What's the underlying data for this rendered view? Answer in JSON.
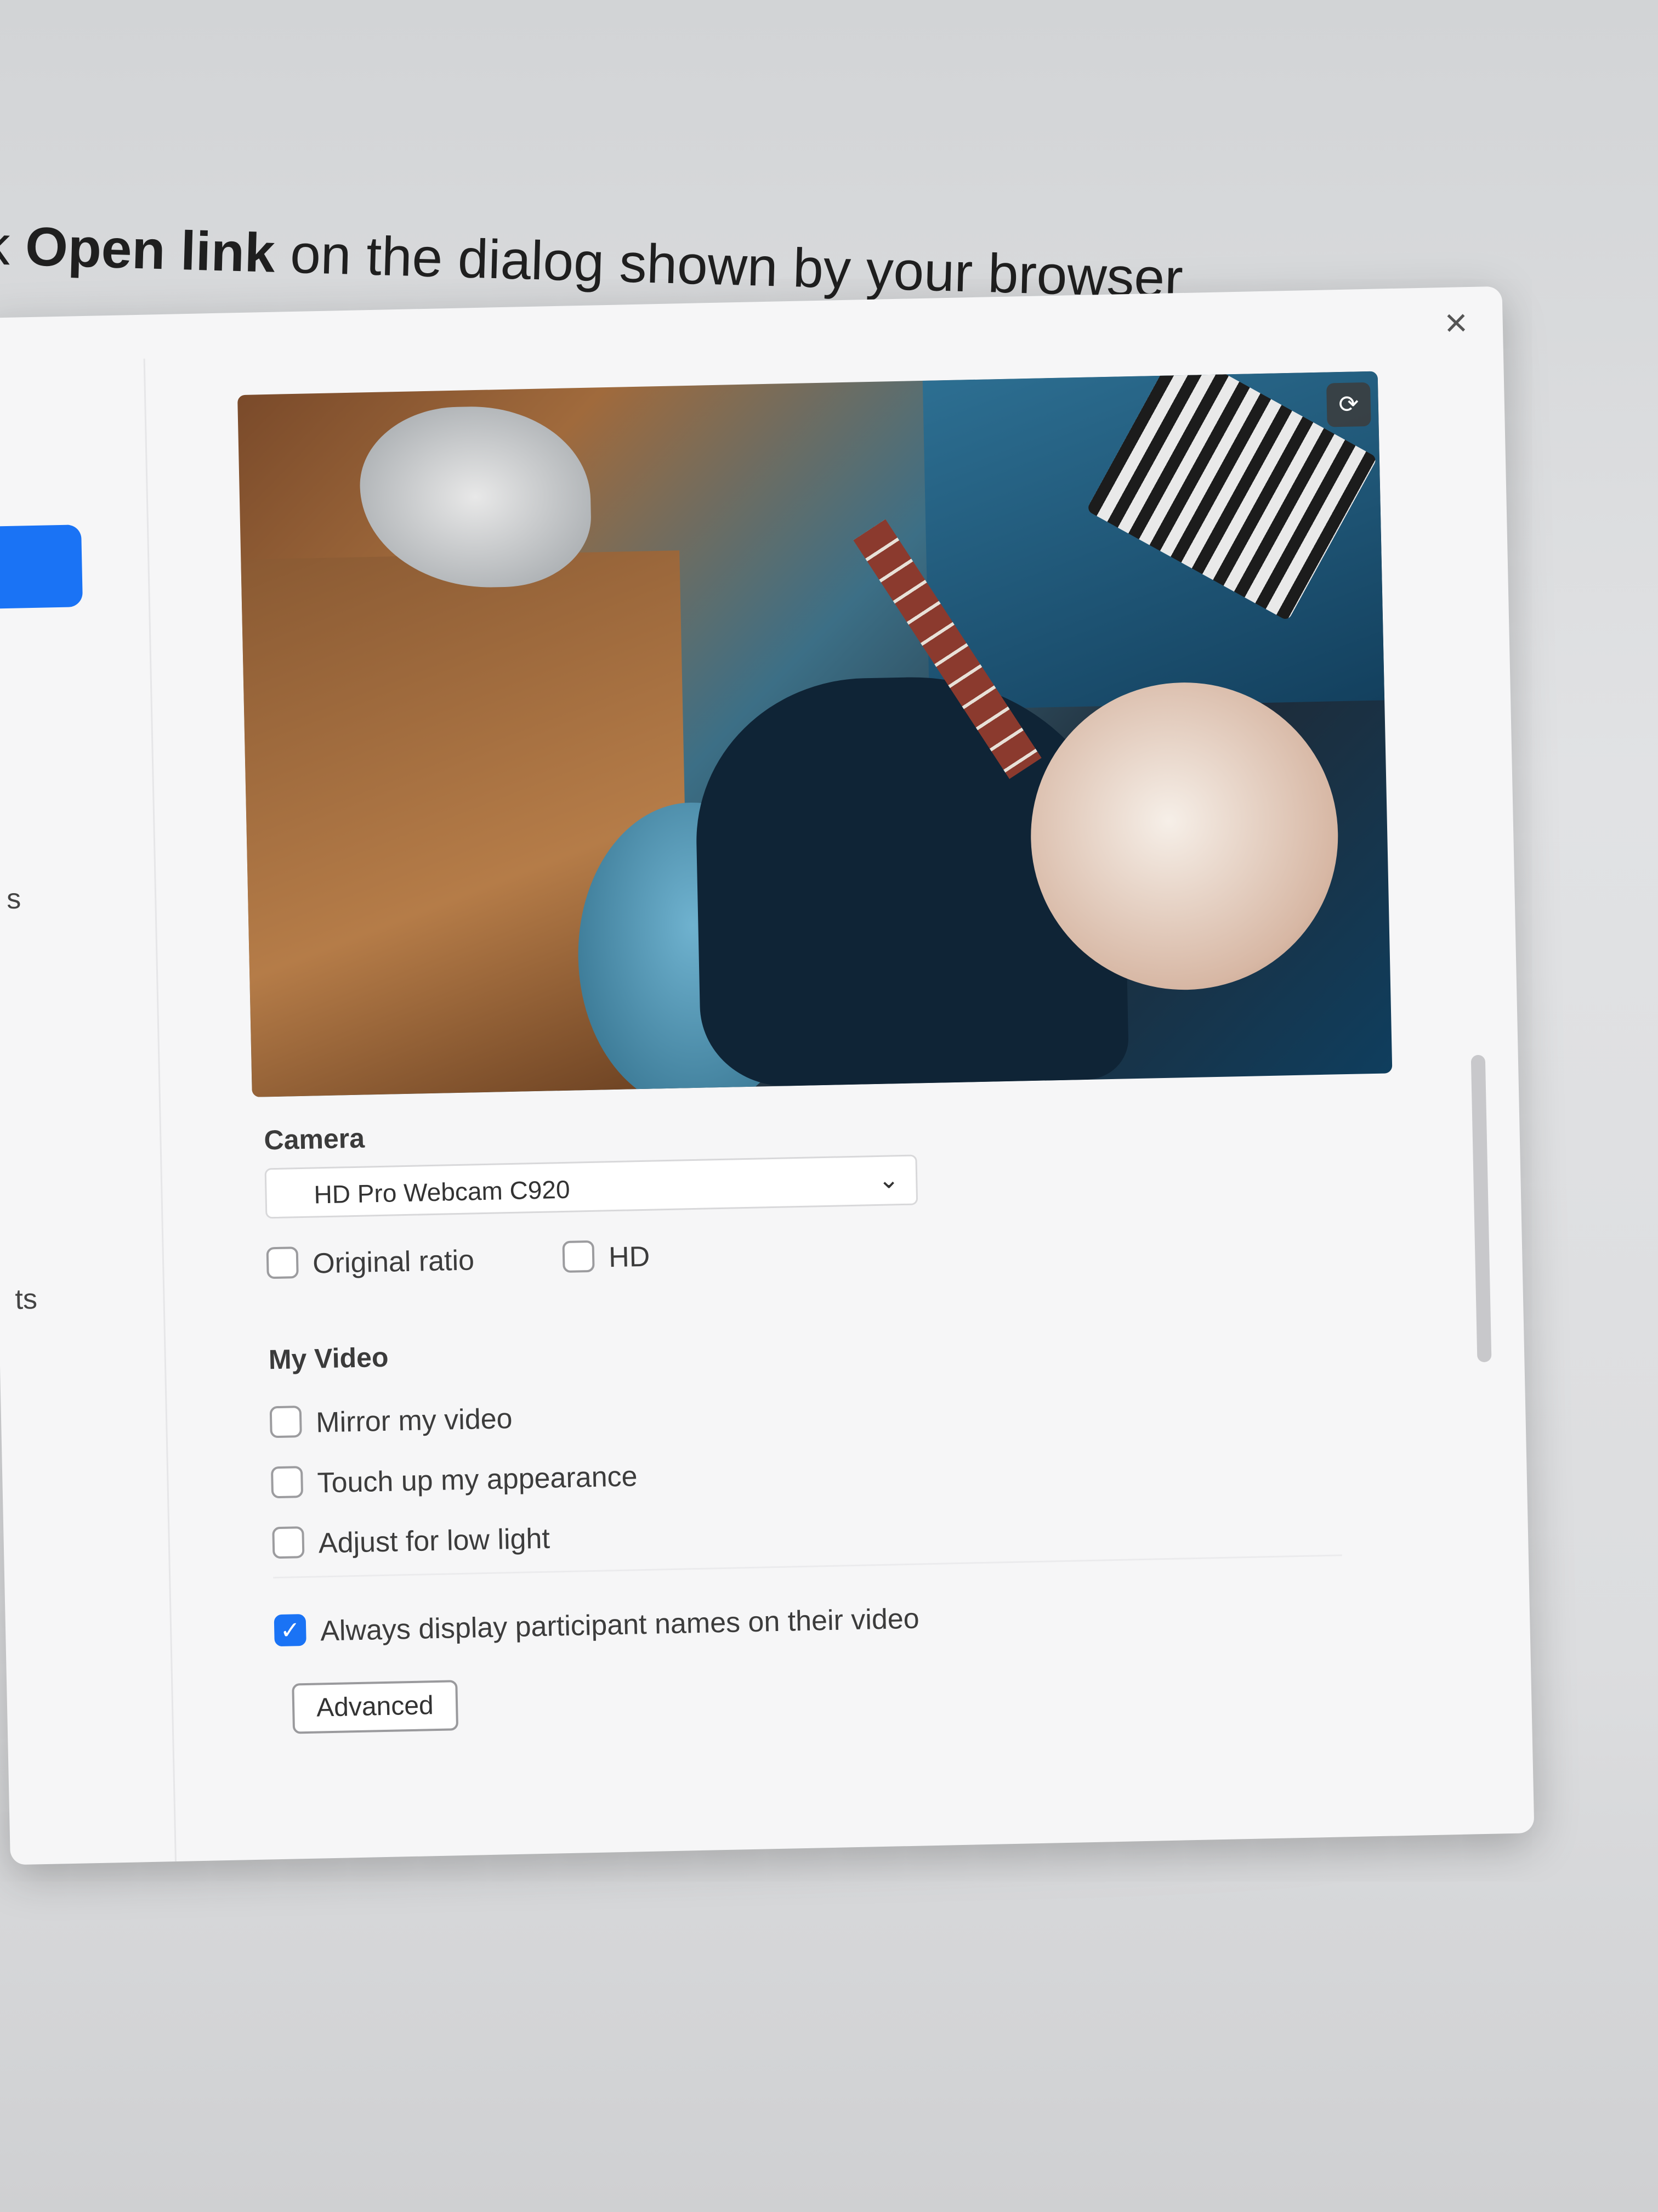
{
  "header": {
    "instruction_prefix": "k ",
    "instruction_bold": "Open link",
    "instruction_suffix": " on the dialog shown by your browser"
  },
  "sidebar": {
    "letter_a": "s",
    "letter_b": "ts"
  },
  "dialog": {
    "close_icon": "close-icon",
    "preview": {
      "switch_camera_icon": "camera-switch-icon"
    },
    "camera": {
      "label": "Camera",
      "selected": "HD Pro Webcam C920",
      "options": [
        {
          "label": "Original ratio",
          "checked": false
        },
        {
          "label": "HD",
          "checked": false
        }
      ]
    },
    "my_video": {
      "label": "My Video",
      "options": [
        {
          "label": "Mirror my video",
          "checked": false
        },
        {
          "label": "Touch up my appearance",
          "checked": false
        },
        {
          "label": "Adjust for low light",
          "checked": false
        }
      ]
    },
    "participant_names": {
      "label": "Always display participant names on their video",
      "checked": true
    },
    "advanced_button": "Advanced"
  },
  "colors": {
    "accent": "#1a73f5",
    "dialog_bg": "#f6f6f7"
  }
}
